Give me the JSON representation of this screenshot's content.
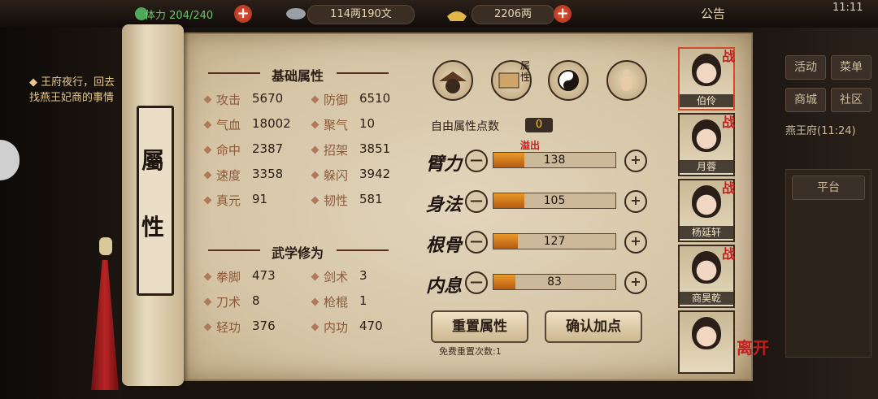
{
  "topbar": {
    "stamina": "204/240",
    "stamina_prefix": "体力",
    "money": "114两190文",
    "gold": "2206两",
    "notice": "公告",
    "time": "11:11"
  },
  "quest": {
    "text": "王府夜行，回去找燕王妃商的事情"
  },
  "side_menu": {
    "activity": "活动",
    "menu": "菜单",
    "shop": "商城",
    "community": "社区",
    "location": "燕王府",
    "location_time": "(11:24)",
    "platform": "平台"
  },
  "scroll": {
    "char1": "屬",
    "char2": "性"
  },
  "basic": {
    "title": "基础属性",
    "stats": [
      {
        "label": "攻击",
        "value": "5670"
      },
      {
        "label": "防御",
        "value": "6510"
      },
      {
        "label": "气血",
        "value": "18002"
      },
      {
        "label": "聚气",
        "value": "10"
      },
      {
        "label": "命中",
        "value": "2387"
      },
      {
        "label": "招架",
        "value": "3851"
      },
      {
        "label": "速度",
        "value": "3358"
      },
      {
        "label": "躲闪",
        "value": "3942"
      },
      {
        "label": "真元",
        "value": "91"
      },
      {
        "label": "韧性",
        "value": "581"
      }
    ]
  },
  "martial": {
    "title": "武学修为",
    "stats": [
      {
        "label": "拳脚",
        "value": "473"
      },
      {
        "label": "剑术",
        "value": "3"
      },
      {
        "label": "刀术",
        "value": "8"
      },
      {
        "label": "枪棍",
        "value": "1"
      },
      {
        "label": "轻功",
        "value": "376"
      },
      {
        "label": "内功",
        "value": "470"
      }
    ]
  },
  "tabs": {
    "attribute_tab_label": "属性",
    "icons": [
      "hat-icon",
      "scroll-book-icon",
      "taiji-icon",
      "body-icon"
    ]
  },
  "points": {
    "free_label": "自由属性点数",
    "free_value": "0",
    "overflow": "溢出",
    "attrs": [
      {
        "name": "臂力",
        "value": "138",
        "fill": 0.25
      },
      {
        "name": "身法",
        "value": "105",
        "fill": 0.25
      },
      {
        "name": "根骨",
        "value": "127",
        "fill": 0.2
      },
      {
        "name": "内息",
        "value": "83",
        "fill": 0.18
      }
    ],
    "minus": "—",
    "plus": "+",
    "reset_label": "重置属性",
    "confirm_label": "确认加点",
    "free_reset": "免费重置次数:1"
  },
  "party": [
    {
      "name": "伯伶",
      "tag": "战",
      "selected": true
    },
    {
      "name": "月蓉",
      "tag": "战"
    },
    {
      "name": "杨延轩",
      "tag": "战"
    },
    {
      "name": "商昊乾",
      "tag": "战"
    },
    {
      "name": "",
      "tag": ""
    }
  ],
  "leave": "离开",
  "colors": {
    "accent": "#c21f1f",
    "bar": "#e89a2a",
    "paper": "#e2d5bc"
  }
}
